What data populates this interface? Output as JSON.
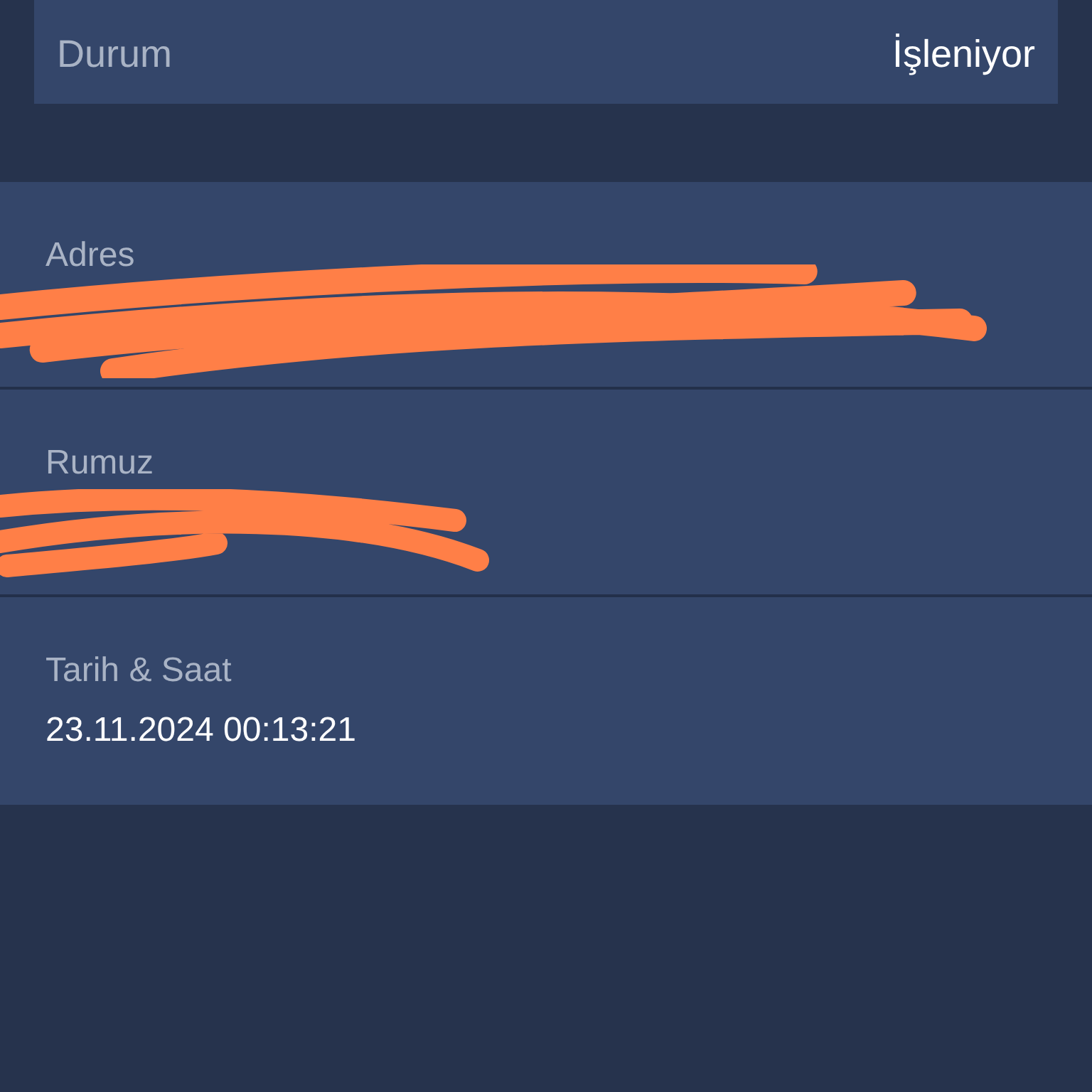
{
  "status": {
    "label": "Durum",
    "value": "İşleniyor"
  },
  "details": [
    {
      "label": "Adres",
      "redacted": true
    },
    {
      "label": "Rumuz",
      "redacted": true
    },
    {
      "label": "Tarih & Saat",
      "value": "23.11.2024 00:13:21",
      "redacted": false
    }
  ]
}
